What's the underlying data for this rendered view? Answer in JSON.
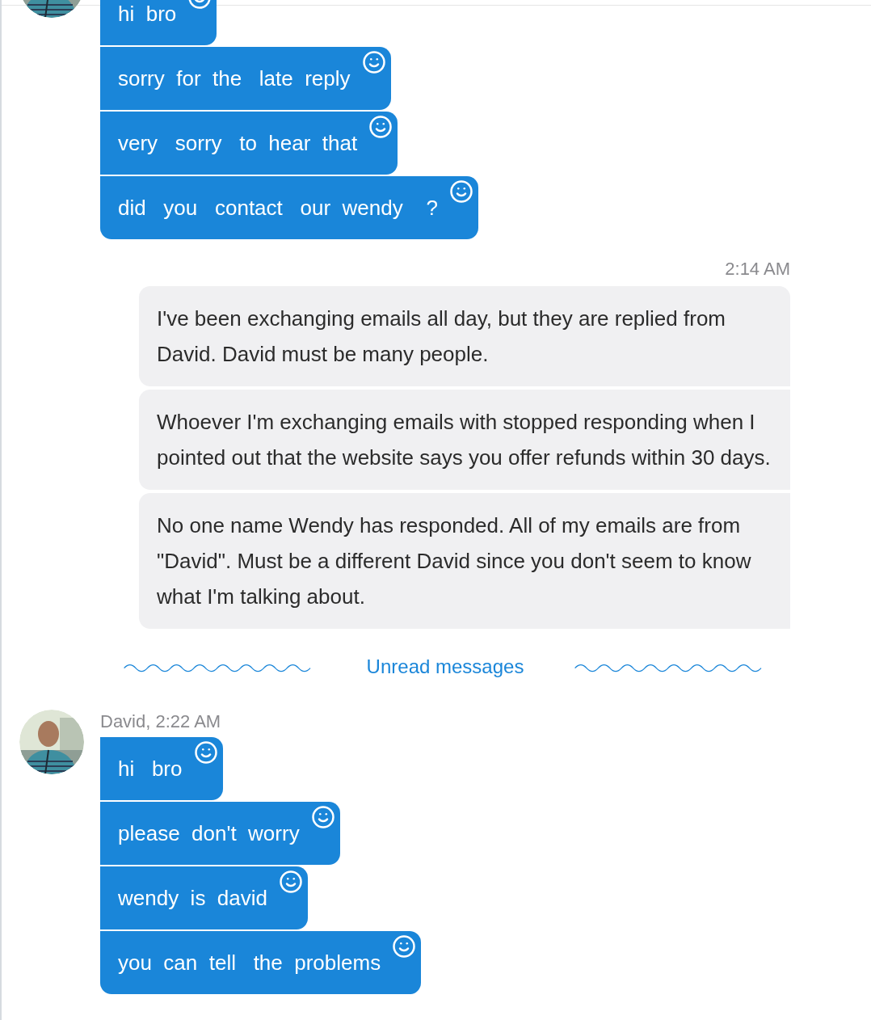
{
  "conversation": [
    {
      "kind": "incoming",
      "bubbles": [
        "hi  bro",
        "sorry  for  the   late  reply",
        "very   sorry   to  hear  that",
        "did   you   contact   our  wendy    ?"
      ]
    },
    {
      "kind": "outgoing",
      "time": "2:14 AM",
      "bubbles": [
        "I've been exchanging emails all day, but they are replied from David. David must be many people.",
        "Whoever I'm exchanging emails with stopped responding when I pointed out that the website says you offer refunds within 30 days.",
        "No one name Wendy has responded. All of my emails are from \"David\". Must be a different David since you don't seem to know what I'm talking about."
      ]
    },
    {
      "kind": "divider",
      "label": "Unread messages"
    },
    {
      "kind": "incoming",
      "sender": "David, 2:22 AM",
      "bubbles": [
        "hi   bro",
        "please  don't  worry",
        "wendy  is  david",
        "you  can  tell   the  problems"
      ]
    }
  ]
}
